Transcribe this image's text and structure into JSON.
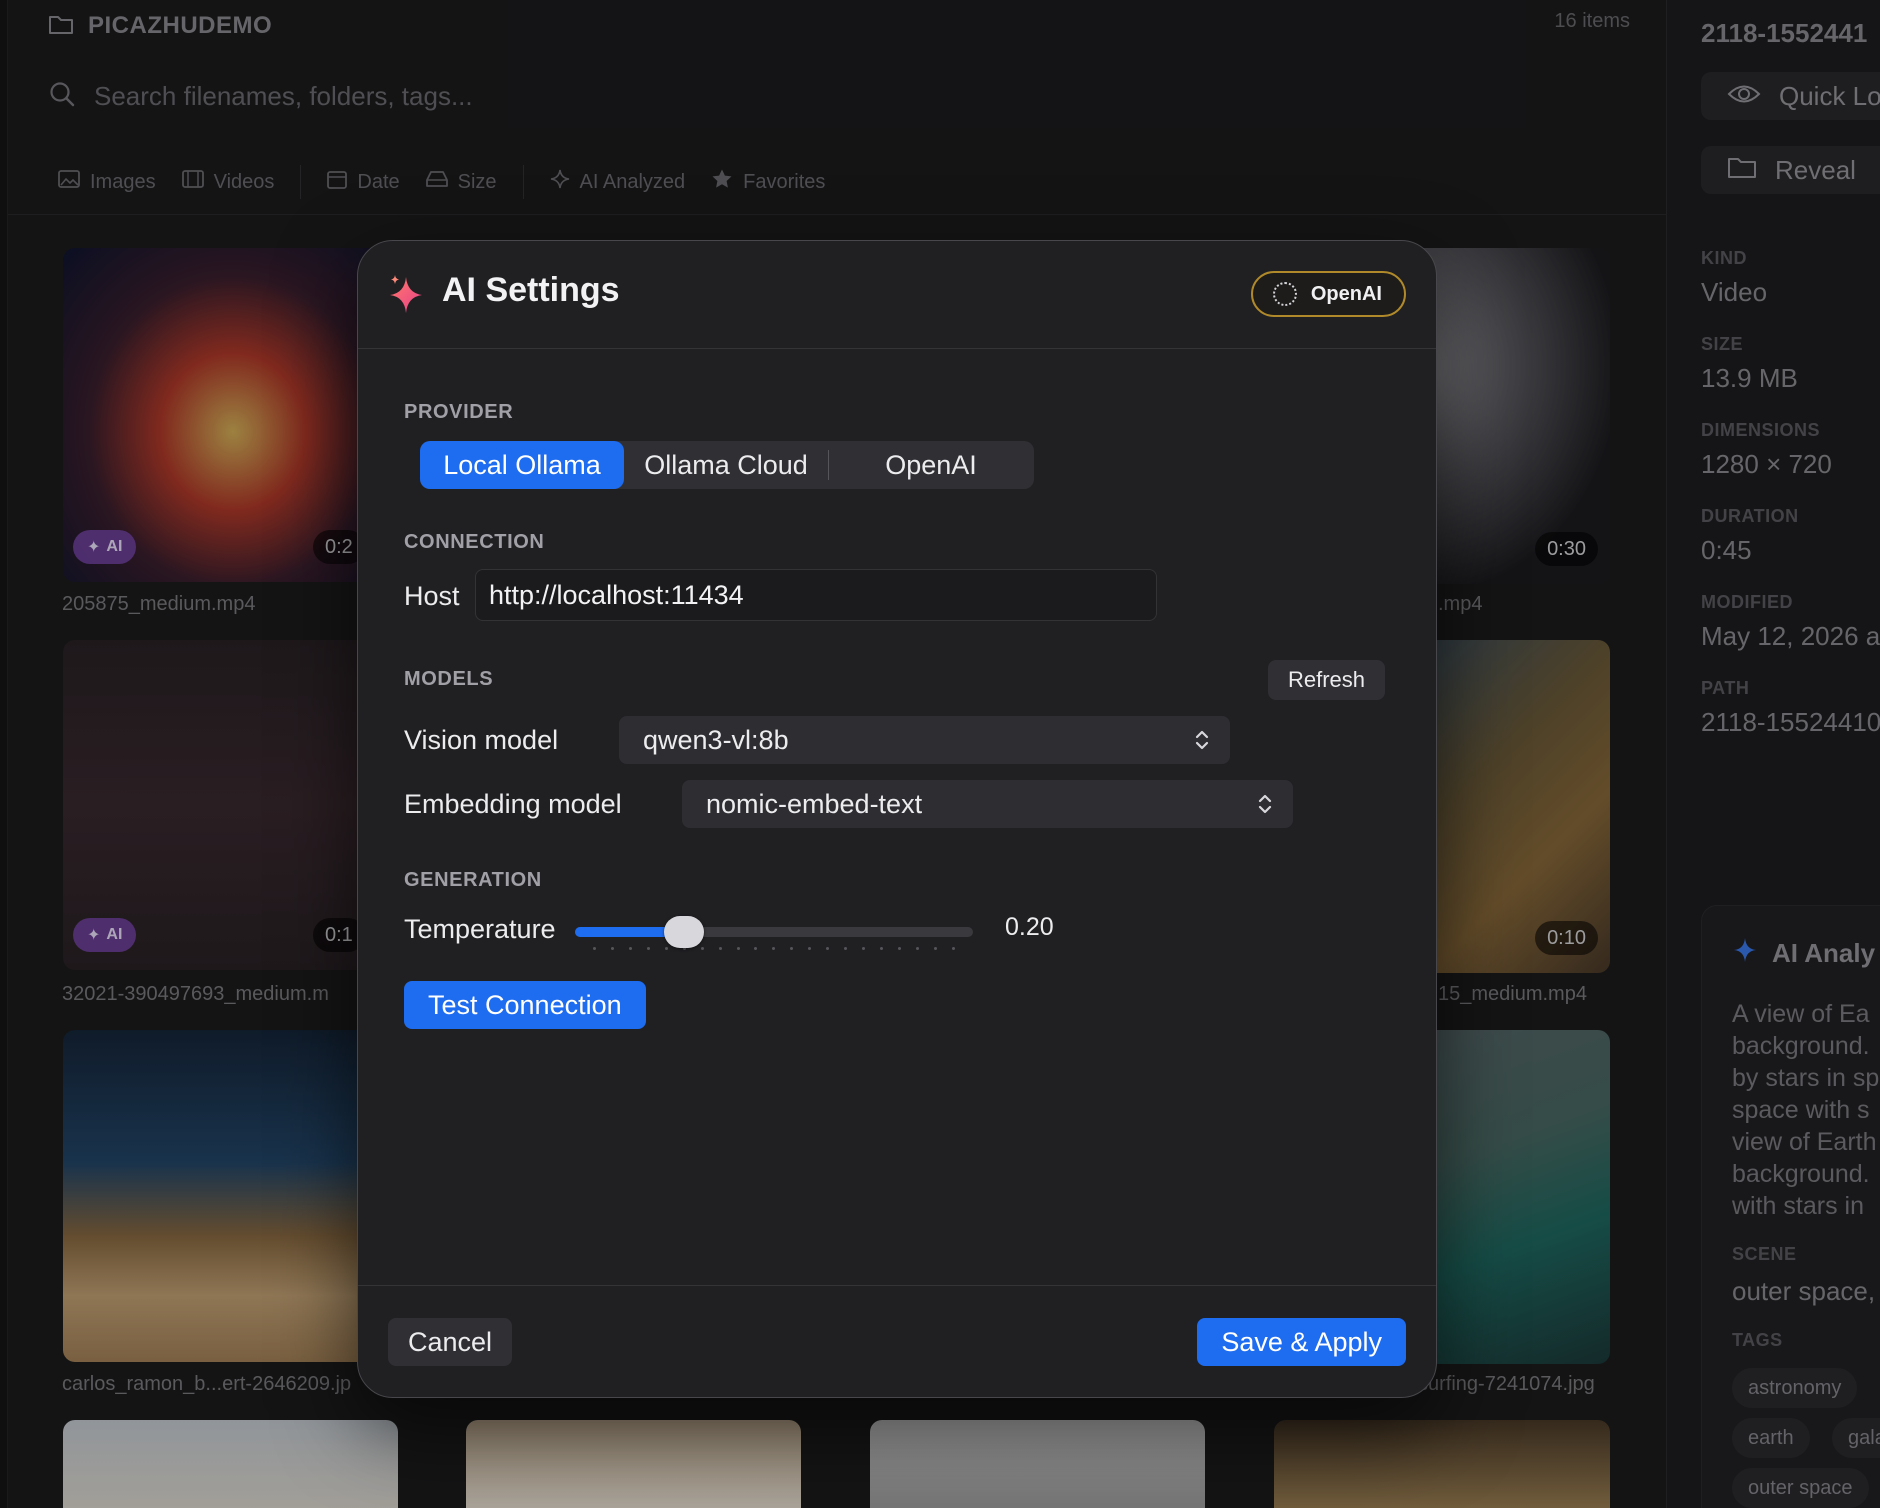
{
  "app": {
    "library_title": "PICAZHUDEMO",
    "item_count": "16 items",
    "search": {
      "placeholder": "Search filenames, folders, tags..."
    },
    "filters": [
      "Images",
      "Videos",
      "Date",
      "Size",
      "AI Analyzed",
      "Favorites"
    ]
  },
  "grid": {
    "tiles": [
      {
        "label": "205875_medium.mp4",
        "ai_badge": "AI",
        "duration": "0:2"
      },
      {
        "label": ".mp4",
        "duration": "0:30"
      },
      {
        "label": "32021-390497693_medium.m",
        "ai_badge": "AI",
        "duration": "0:1"
      },
      {
        "label": "15_medium.mp4",
        "duration": "0:10"
      },
      {
        "label": "carlos_ramon_b...ert-2646209.jp"
      },
      {
        "label": "surfing-7241074.jpg"
      }
    ]
  },
  "inspector": {
    "title": "2118-1552441",
    "quick_look": "Quick Lo",
    "reveal": "Reveal",
    "meta": [
      {
        "key": "KIND",
        "value": "Video"
      },
      {
        "key": "SIZE",
        "value": "13.9 MB"
      },
      {
        "key": "DIMENSIONS",
        "value": "1280 × 720"
      },
      {
        "key": "DURATION",
        "value": "0:45"
      },
      {
        "key": "MODIFIED",
        "value": "May 12, 2026 a"
      },
      {
        "key": "PATH",
        "value": "2118-15524410"
      }
    ],
    "ai_analysis": {
      "title": "AI Analy",
      "description": "A view of Ea\nbackground.\nby stars in sp\nspace with s\nview of Earth\nbackground.\nwith stars in",
      "scene_label": "SCENE",
      "scene_value": "outer space,",
      "tags_label": "TAGS",
      "tags": [
        "astronomy",
        "earth",
        "gala",
        "outer space"
      ]
    }
  },
  "modal": {
    "title": "AI Settings",
    "status_pill": "OpenAI",
    "provider": {
      "label": "PROVIDER",
      "options": [
        "Local Ollama",
        "Ollama Cloud",
        "OpenAI"
      ],
      "selected": "Local Ollama"
    },
    "connection": {
      "label": "CONNECTION",
      "host_label": "Host",
      "host_value": "http://localhost:11434"
    },
    "models": {
      "label": "MODELS",
      "refresh": "Refresh",
      "vision_label": "Vision model",
      "vision_value": "qwen3-vl:8b",
      "embedding_label": "Embedding model",
      "embedding_value": "nomic-embed-text"
    },
    "generation": {
      "label": "GENERATION",
      "temperature_label": "Temperature",
      "temperature_display": "0.20",
      "temperature_value": 0.2,
      "temperature_max": 1.0
    },
    "test_connection": "Test Connection",
    "cancel": "Cancel",
    "save_apply": "Save & Apply",
    "colors": {
      "accent": "#1e6cf0",
      "sparkle": "#ff5a8a",
      "pill_border": "#b08a2a"
    }
  }
}
